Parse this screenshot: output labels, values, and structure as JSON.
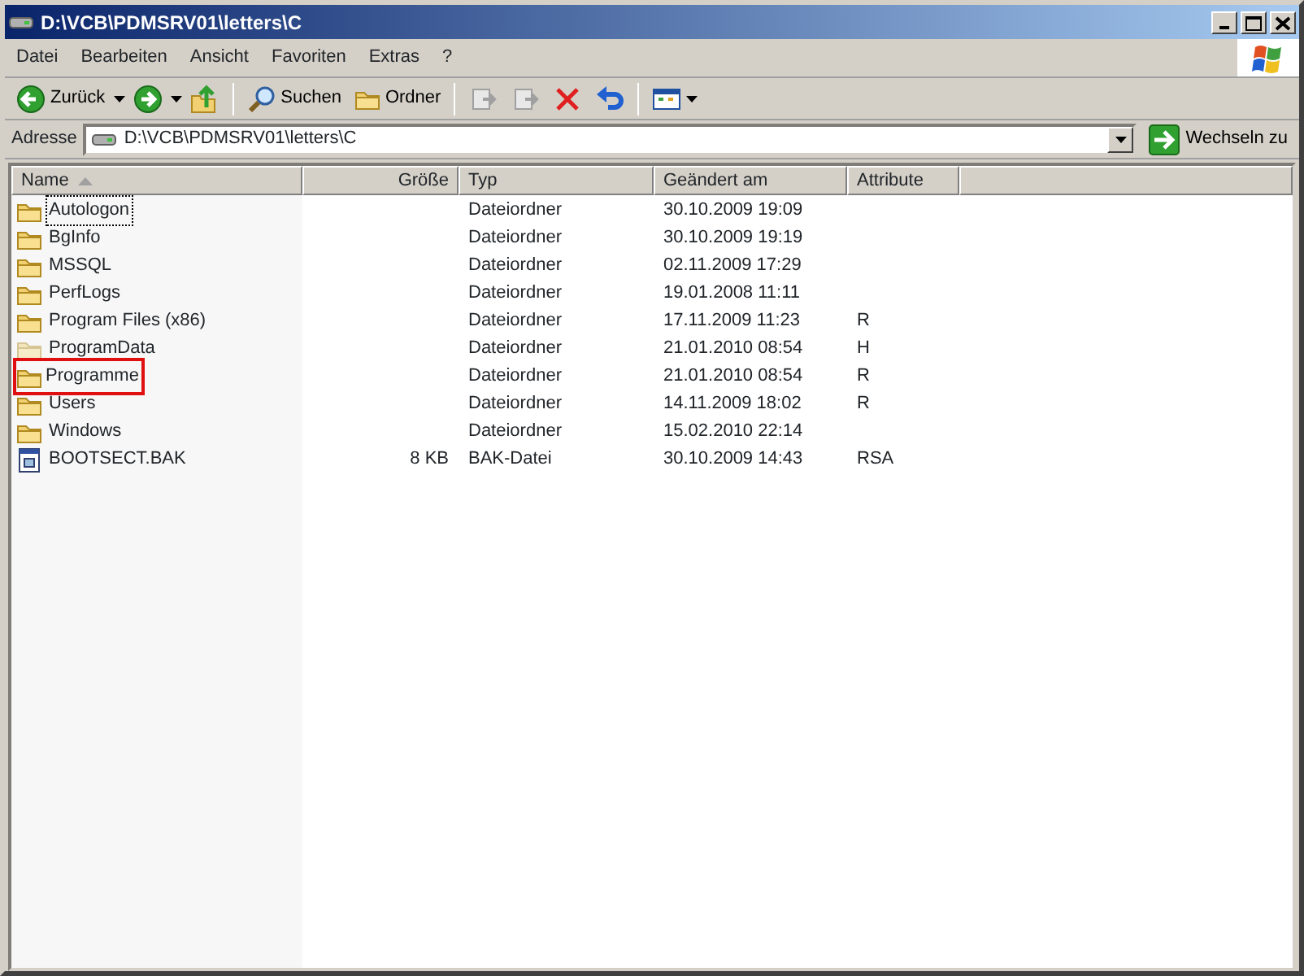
{
  "window": {
    "title": "D:\\VCB\\PDMSRV01\\letters\\C"
  },
  "menu": [
    "Datei",
    "Bearbeiten",
    "Ansicht",
    "Favoriten",
    "Extras",
    "?"
  ],
  "toolbar": {
    "back": "Zurück",
    "search": "Suchen",
    "folders": "Ordner"
  },
  "address": {
    "label": "Adresse",
    "value": "D:\\VCB\\PDMSRV01\\letters\\C",
    "go": "Wechseln zu"
  },
  "table": {
    "columns": [
      {
        "label": "Name",
        "sorted": true
      },
      {
        "label": "Größe",
        "sorted": false
      },
      {
        "label": "Typ",
        "sorted": false
      },
      {
        "label": "Geändert am",
        "sorted": false
      },
      {
        "label": "Attribute",
        "sorted": false
      }
    ],
    "rows": [
      {
        "kind": "folder",
        "name": "Autologon",
        "size": "",
        "type": "Dateiordner",
        "modified": "30.10.2009 19:09",
        "attributes": "",
        "focused": true,
        "highlighted": false,
        "hidden": false
      },
      {
        "kind": "folder",
        "name": "BgInfo",
        "size": "",
        "type": "Dateiordner",
        "modified": "30.10.2009 19:19",
        "attributes": "",
        "focused": false,
        "highlighted": false,
        "hidden": false
      },
      {
        "kind": "folder",
        "name": "MSSQL",
        "size": "",
        "type": "Dateiordner",
        "modified": "02.11.2009 17:29",
        "attributes": "",
        "focused": false,
        "highlighted": false,
        "hidden": false
      },
      {
        "kind": "folder",
        "name": "PerfLogs",
        "size": "",
        "type": "Dateiordner",
        "modified": "19.01.2008 11:11",
        "attributes": "",
        "focused": false,
        "highlighted": false,
        "hidden": false
      },
      {
        "kind": "folder",
        "name": "Program Files (x86)",
        "size": "",
        "type": "Dateiordner",
        "modified": "17.11.2009 11:23",
        "attributes": "R",
        "focused": false,
        "highlighted": false,
        "hidden": false
      },
      {
        "kind": "folder",
        "name": "ProgramData",
        "size": "",
        "type": "Dateiordner",
        "modified": "21.01.2010 08:54",
        "attributes": "H",
        "focused": false,
        "highlighted": false,
        "hidden": true
      },
      {
        "kind": "folder",
        "name": "Programme",
        "size": "",
        "type": "Dateiordner",
        "modified": "21.01.2010 08:54",
        "attributes": "R",
        "focused": false,
        "highlighted": true,
        "hidden": false
      },
      {
        "kind": "folder",
        "name": "Users",
        "size": "",
        "type": "Dateiordner",
        "modified": "14.11.2009 18:02",
        "attributes": "R",
        "focused": false,
        "highlighted": false,
        "hidden": false
      },
      {
        "kind": "folder",
        "name": "Windows",
        "size": "",
        "type": "Dateiordner",
        "modified": "15.02.2010 22:14",
        "attributes": "",
        "focused": false,
        "highlighted": false,
        "hidden": false
      },
      {
        "kind": "file",
        "name": "BOOTSECT.BAK",
        "size": "8 KB",
        "type": "BAK-Datei",
        "modified": "30.10.2009 14:43",
        "attributes": "RSA",
        "focused": false,
        "highlighted": false,
        "hidden": false
      }
    ]
  }
}
